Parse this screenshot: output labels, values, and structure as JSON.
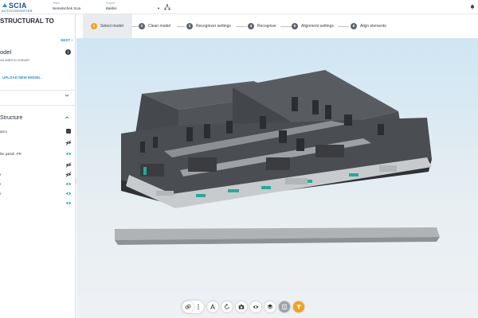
{
  "topbar": {
    "logo_main": "SCIA",
    "logo_sub": "AUTOCONVERTER",
    "team_label": "Team",
    "team_value": "Nemetschek Scia",
    "project_label": "Project",
    "project_value": "Baldini"
  },
  "sidebar": {
    "title": "STRUCTURAL TO",
    "next_label": "NEXT",
    "model_label": "odel",
    "hint": "ou want to convert",
    "upload_label": "UPLOAD NEW MODEL",
    "structure_label": "Structure",
    "layers": [
      {
        "text": "atico",
        "icon": "square-icon"
      },
      {
        "text": "",
        "icon": "eye-off-icon"
      },
      {
        "text": "ller pattuh -PR",
        "icon": "eye-icon"
      },
      {
        "text": "",
        "icon": "eye-off-icon"
      },
      {
        "text": "r",
        "icon": "eye-off-icon"
      },
      {
        "text": "r",
        "icon": "eye-icon"
      },
      {
        "text": "r",
        "icon": "eye-icon"
      },
      {
        "text": "",
        "icon": "eye-icon"
      }
    ]
  },
  "stepper": {
    "steps": [
      {
        "num": "1",
        "label": "Select model"
      },
      {
        "num": "2",
        "label": "Clean model"
      },
      {
        "num": "3",
        "label": "Recognizer settings"
      },
      {
        "num": "4",
        "label": "Recognise"
      },
      {
        "num": "5",
        "label": "Alignment settings"
      },
      {
        "num": "6",
        "label": "Align elements"
      }
    ],
    "active_color": "#f5a21a"
  },
  "toolbar": {
    "icons": [
      "orbit-icon",
      "more-vertical-icon",
      "text-icon",
      "rotate-icon",
      "camera-icon",
      "eye-icon",
      "layers-icon",
      "panel-icon",
      "filter-icon"
    ]
  },
  "colors": {
    "brand": "#1e4f8c",
    "link": "#2e8ccf",
    "accent": "#f5a21a",
    "building": "#4a4d52",
    "slab": "#8d9196",
    "teal": "#2aa899"
  }
}
